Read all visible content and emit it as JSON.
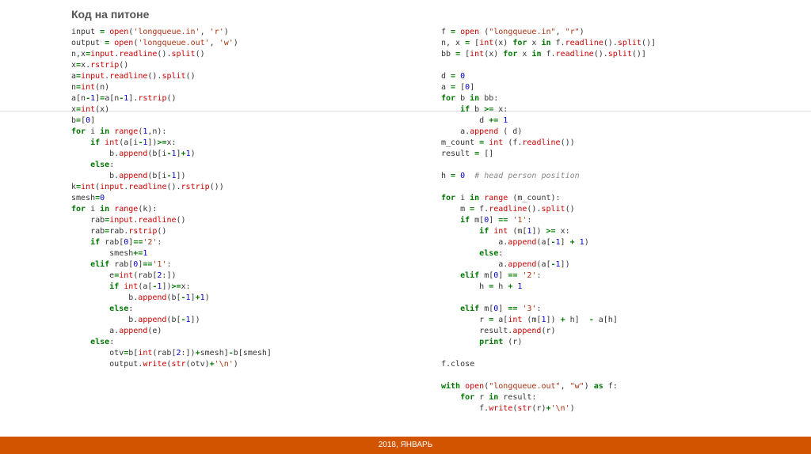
{
  "title": "Код на питоне",
  "footer": "2018, ЯНВАРЬ",
  "code_left": [
    [
      [
        "id",
        "input "
      ],
      [
        "kw",
        "="
      ],
      [
        "id",
        " "
      ],
      [
        "fn",
        "open"
      ],
      [
        "id",
        "("
      ],
      [
        "str",
        "'longqueue.in'"
      ],
      [
        "id",
        ", "
      ],
      [
        "str",
        "'r'"
      ],
      [
        "id",
        ")"
      ]
    ],
    [
      [
        "id",
        "output "
      ],
      [
        "kw",
        "="
      ],
      [
        "id",
        " "
      ],
      [
        "fn",
        "open"
      ],
      [
        "id",
        "("
      ],
      [
        "str",
        "'longqueue.out'"
      ],
      [
        "id",
        ", "
      ],
      [
        "str",
        "'w'"
      ],
      [
        "id",
        ")"
      ]
    ],
    [
      [
        "id",
        "n,x"
      ],
      [
        "kw",
        "="
      ],
      [
        "fn",
        "input"
      ],
      [
        "id",
        "."
      ],
      [
        "fn",
        "readline"
      ],
      [
        "id",
        "()."
      ],
      [
        "fn",
        "split"
      ],
      [
        "id",
        "()"
      ]
    ],
    [
      [
        "id",
        "x"
      ],
      [
        "kw",
        "="
      ],
      [
        "id",
        "x."
      ],
      [
        "fn",
        "rstrip"
      ],
      [
        "id",
        "()"
      ]
    ],
    [
      [
        "id",
        "a"
      ],
      [
        "kw",
        "="
      ],
      [
        "fn",
        "input"
      ],
      [
        "id",
        "."
      ],
      [
        "fn",
        "readline"
      ],
      [
        "id",
        "()."
      ],
      [
        "fn",
        "split"
      ],
      [
        "id",
        "()"
      ]
    ],
    [
      [
        "id",
        "n"
      ],
      [
        "kw",
        "="
      ],
      [
        "fn",
        "int"
      ],
      [
        "id",
        "(n)"
      ]
    ],
    [
      [
        "id",
        "a[n"
      ],
      [
        "kw",
        "-"
      ],
      [
        "num",
        "1"
      ],
      [
        "id",
        "]"
      ],
      [
        "kw",
        "="
      ],
      [
        "id",
        "a[n"
      ],
      [
        "kw",
        "-"
      ],
      [
        "num",
        "1"
      ],
      [
        "id",
        "]."
      ],
      [
        "fn",
        "rstrip"
      ],
      [
        "id",
        "()"
      ]
    ],
    [
      [
        "id",
        "x"
      ],
      [
        "kw",
        "="
      ],
      [
        "fn",
        "int"
      ],
      [
        "id",
        "(x)"
      ]
    ],
    [
      [
        "id",
        "b"
      ],
      [
        "kw",
        "="
      ],
      [
        "id",
        "["
      ],
      [
        "num",
        "0"
      ],
      [
        "id",
        "]"
      ]
    ],
    [
      [
        "kw",
        "for"
      ],
      [
        "id",
        " i "
      ],
      [
        "kw",
        "in"
      ],
      [
        "id",
        " "
      ],
      [
        "fn",
        "range"
      ],
      [
        "id",
        "("
      ],
      [
        "num",
        "1"
      ],
      [
        "id",
        ",n):"
      ]
    ],
    [
      [
        "id",
        "    "
      ],
      [
        "kw",
        "if"
      ],
      [
        "id",
        " "
      ],
      [
        "fn",
        "int"
      ],
      [
        "id",
        "(a[i"
      ],
      [
        "kw",
        "-"
      ],
      [
        "num",
        "1"
      ],
      [
        "id",
        "])"
      ],
      [
        "kw",
        ">="
      ],
      [
        "id",
        "x:"
      ]
    ],
    [
      [
        "id",
        "        b."
      ],
      [
        "fn",
        "append"
      ],
      [
        "id",
        "(b[i"
      ],
      [
        "kw",
        "-"
      ],
      [
        "num",
        "1"
      ],
      [
        "id",
        "]"
      ],
      [
        "kw",
        "+"
      ],
      [
        "num",
        "1"
      ],
      [
        "id",
        ")"
      ]
    ],
    [
      [
        "id",
        "    "
      ],
      [
        "kw",
        "else"
      ],
      [
        "id",
        ":"
      ]
    ],
    [
      [
        "id",
        "        b."
      ],
      [
        "fn",
        "append"
      ],
      [
        "id",
        "(b[i"
      ],
      [
        "kw",
        "-"
      ],
      [
        "num",
        "1"
      ],
      [
        "id",
        "])"
      ]
    ],
    [
      [
        "id",
        "k"
      ],
      [
        "kw",
        "="
      ],
      [
        "fn",
        "int"
      ],
      [
        "id",
        "("
      ],
      [
        "fn",
        "input"
      ],
      [
        "id",
        "."
      ],
      [
        "fn",
        "readline"
      ],
      [
        "id",
        "()."
      ],
      [
        "fn",
        "rstrip"
      ],
      [
        "id",
        "())"
      ]
    ],
    [
      [
        "id",
        "smesh"
      ],
      [
        "kw",
        "="
      ],
      [
        "num",
        "0"
      ]
    ],
    [
      [
        "kw",
        "for"
      ],
      [
        "id",
        " i "
      ],
      [
        "kw",
        "in"
      ],
      [
        "id",
        " "
      ],
      [
        "fn",
        "range"
      ],
      [
        "id",
        "(k):"
      ]
    ],
    [
      [
        "id",
        "    rab"
      ],
      [
        "kw",
        "="
      ],
      [
        "fn",
        "input"
      ],
      [
        "id",
        "."
      ],
      [
        "fn",
        "readline"
      ],
      [
        "id",
        "()"
      ]
    ],
    [
      [
        "id",
        "    rab"
      ],
      [
        "kw",
        "="
      ],
      [
        "id",
        "rab."
      ],
      [
        "fn",
        "rstrip"
      ],
      [
        "id",
        "()"
      ]
    ],
    [
      [
        "id",
        "    "
      ],
      [
        "kw",
        "if"
      ],
      [
        "id",
        " rab["
      ],
      [
        "num",
        "0"
      ],
      [
        "id",
        "]"
      ],
      [
        "kw",
        "=="
      ],
      [
        "str",
        "'2'"
      ],
      [
        "id",
        ":"
      ]
    ],
    [
      [
        "id",
        "        smesh"
      ],
      [
        "kw",
        "+="
      ],
      [
        "num",
        "1"
      ]
    ],
    [
      [
        "id",
        "    "
      ],
      [
        "kw",
        "elif"
      ],
      [
        "id",
        " rab["
      ],
      [
        "num",
        "0"
      ],
      [
        "id",
        "]"
      ],
      [
        "kw",
        "=="
      ],
      [
        "str",
        "'1'"
      ],
      [
        "id",
        ":"
      ]
    ],
    [
      [
        "id",
        "        e"
      ],
      [
        "kw",
        "="
      ],
      [
        "fn",
        "int"
      ],
      [
        "id",
        "(rab["
      ],
      [
        "num",
        "2"
      ],
      [
        "id",
        ":])"
      ]
    ],
    [
      [
        "id",
        "        "
      ],
      [
        "kw",
        "if"
      ],
      [
        "id",
        " "
      ],
      [
        "fn",
        "int"
      ],
      [
        "id",
        "(a["
      ],
      [
        "kw",
        "-"
      ],
      [
        "num",
        "1"
      ],
      [
        "id",
        "])"
      ],
      [
        "kw",
        ">="
      ],
      [
        "id",
        "x:"
      ]
    ],
    [
      [
        "id",
        "            b."
      ],
      [
        "fn",
        "append"
      ],
      [
        "id",
        "(b["
      ],
      [
        "kw",
        "-"
      ],
      [
        "num",
        "1"
      ],
      [
        "id",
        "]"
      ],
      [
        "kw",
        "+"
      ],
      [
        "num",
        "1"
      ],
      [
        "id",
        ")"
      ]
    ],
    [
      [
        "id",
        "        "
      ],
      [
        "kw",
        "else"
      ],
      [
        "id",
        ":"
      ]
    ],
    [
      [
        "id",
        "            b."
      ],
      [
        "fn",
        "append"
      ],
      [
        "id",
        "(b["
      ],
      [
        "kw",
        "-"
      ],
      [
        "num",
        "1"
      ],
      [
        "id",
        "])"
      ]
    ],
    [
      [
        "id",
        "        a."
      ],
      [
        "fn",
        "append"
      ],
      [
        "id",
        "(e)"
      ]
    ],
    [
      [
        "id",
        "    "
      ],
      [
        "kw",
        "else"
      ],
      [
        "id",
        ":"
      ]
    ],
    [
      [
        "id",
        "        otv"
      ],
      [
        "kw",
        "="
      ],
      [
        "id",
        "b["
      ],
      [
        "fn",
        "int"
      ],
      [
        "id",
        "(rab["
      ],
      [
        "num",
        "2"
      ],
      [
        "id",
        ":])"
      ],
      [
        "kw",
        "+"
      ],
      [
        "id",
        "smesh]"
      ],
      [
        "kw",
        "-"
      ],
      [
        "id",
        "b[smesh]"
      ]
    ],
    [
      [
        "id",
        "        output."
      ],
      [
        "fn",
        "write"
      ],
      [
        "id",
        "("
      ],
      [
        "fn",
        "str"
      ],
      [
        "id",
        "(otv)"
      ],
      [
        "kw",
        "+"
      ],
      [
        "str",
        "'\\n'"
      ],
      [
        "id",
        ")"
      ]
    ]
  ],
  "code_right": [
    [
      [
        "id",
        "f "
      ],
      [
        "kw",
        "="
      ],
      [
        "id",
        " "
      ],
      [
        "fn",
        "open"
      ],
      [
        "id",
        " ("
      ],
      [
        "str",
        "\"longqueue.in\""
      ],
      [
        "id",
        ", "
      ],
      [
        "str",
        "\"r\""
      ],
      [
        "id",
        ")"
      ]
    ],
    [
      [
        "id",
        "n, x "
      ],
      [
        "kw",
        "="
      ],
      [
        "id",
        " ["
      ],
      [
        "fn",
        "int"
      ],
      [
        "id",
        "(x) "
      ],
      [
        "kw",
        "for"
      ],
      [
        "id",
        " x "
      ],
      [
        "kw",
        "in"
      ],
      [
        "id",
        " f."
      ],
      [
        "fn",
        "readline"
      ],
      [
        "id",
        "()."
      ],
      [
        "fn",
        "split"
      ],
      [
        "id",
        "()]"
      ]
    ],
    [
      [
        "id",
        "bb "
      ],
      [
        "kw",
        "="
      ],
      [
        "id",
        " ["
      ],
      [
        "fn",
        "int"
      ],
      [
        "id",
        "(x) "
      ],
      [
        "kw",
        "for"
      ],
      [
        "id",
        " x "
      ],
      [
        "kw",
        "in"
      ],
      [
        "id",
        " f."
      ],
      [
        "fn",
        "readline"
      ],
      [
        "id",
        "()."
      ],
      [
        "fn",
        "split"
      ],
      [
        "id",
        "()]"
      ]
    ],
    [],
    [
      [
        "id",
        "d "
      ],
      [
        "kw",
        "="
      ],
      [
        "id",
        " "
      ],
      [
        "num",
        "0"
      ]
    ],
    [
      [
        "id",
        "a "
      ],
      [
        "kw",
        "="
      ],
      [
        "id",
        " ["
      ],
      [
        "num",
        "0"
      ],
      [
        "id",
        "]"
      ]
    ],
    [
      [
        "kw",
        "for"
      ],
      [
        "id",
        " b "
      ],
      [
        "kw",
        "in"
      ],
      [
        "id",
        " bb:"
      ]
    ],
    [
      [
        "id",
        "    "
      ],
      [
        "kw",
        "if"
      ],
      [
        "id",
        " b "
      ],
      [
        "kw",
        ">="
      ],
      [
        "id",
        " x:"
      ]
    ],
    [
      [
        "id",
        "        d "
      ],
      [
        "kw",
        "+="
      ],
      [
        "id",
        " "
      ],
      [
        "num",
        "1"
      ]
    ],
    [
      [
        "id",
        "    a."
      ],
      [
        "fn",
        "append"
      ],
      [
        "id",
        " ( d)"
      ]
    ],
    [
      [
        "id",
        "m_count "
      ],
      [
        "kw",
        "="
      ],
      [
        "id",
        " "
      ],
      [
        "fn",
        "int"
      ],
      [
        "id",
        " (f."
      ],
      [
        "fn",
        "readline"
      ],
      [
        "id",
        "())"
      ]
    ],
    [
      [
        "id",
        "result "
      ],
      [
        "kw",
        "="
      ],
      [
        "id",
        " []"
      ]
    ],
    [],
    [
      [
        "id",
        "h "
      ],
      [
        "kw",
        "="
      ],
      [
        "id",
        " "
      ],
      [
        "num",
        "0"
      ],
      [
        "id",
        "  "
      ],
      [
        "cm",
        "# head person position"
      ]
    ],
    [],
    [
      [
        "kw",
        "for"
      ],
      [
        "id",
        " i "
      ],
      [
        "kw",
        "in"
      ],
      [
        "id",
        " "
      ],
      [
        "fn",
        "range"
      ],
      [
        "id",
        " (m_count):"
      ]
    ],
    [
      [
        "id",
        "    m "
      ],
      [
        "kw",
        "="
      ],
      [
        "id",
        " f."
      ],
      [
        "fn",
        "readline"
      ],
      [
        "id",
        "()."
      ],
      [
        "fn",
        "split"
      ],
      [
        "id",
        "()"
      ]
    ],
    [
      [
        "id",
        "    "
      ],
      [
        "kw",
        "if"
      ],
      [
        "id",
        " m["
      ],
      [
        "num",
        "0"
      ],
      [
        "id",
        "] "
      ],
      [
        "kw",
        "=="
      ],
      [
        "id",
        " "
      ],
      [
        "str",
        "'1'"
      ],
      [
        "id",
        ":"
      ]
    ],
    [
      [
        "id",
        "        "
      ],
      [
        "kw",
        "if"
      ],
      [
        "id",
        " "
      ],
      [
        "fn",
        "int"
      ],
      [
        "id",
        " (m["
      ],
      [
        "num",
        "1"
      ],
      [
        "id",
        "]) "
      ],
      [
        "kw",
        ">="
      ],
      [
        "id",
        " x:"
      ]
    ],
    [
      [
        "id",
        "            a."
      ],
      [
        "fn",
        "append"
      ],
      [
        "id",
        "(a["
      ],
      [
        "kw",
        "-"
      ],
      [
        "num",
        "1"
      ],
      [
        "id",
        "] "
      ],
      [
        "kw",
        "+"
      ],
      [
        "id",
        " "
      ],
      [
        "num",
        "1"
      ],
      [
        "id",
        ")"
      ]
    ],
    [
      [
        "id",
        "        "
      ],
      [
        "kw",
        "else"
      ],
      [
        "id",
        ":"
      ]
    ],
    [
      [
        "id",
        "            a."
      ],
      [
        "fn",
        "append"
      ],
      [
        "id",
        "(a["
      ],
      [
        "kw",
        "-"
      ],
      [
        "num",
        "1"
      ],
      [
        "id",
        "])"
      ]
    ],
    [
      [
        "id",
        "    "
      ],
      [
        "kw",
        "elif"
      ],
      [
        "id",
        " m["
      ],
      [
        "num",
        "0"
      ],
      [
        "id",
        "] "
      ],
      [
        "kw",
        "=="
      ],
      [
        "id",
        " "
      ],
      [
        "str",
        "'2'"
      ],
      [
        "id",
        ":"
      ]
    ],
    [
      [
        "id",
        "        h "
      ],
      [
        "kw",
        "="
      ],
      [
        "id",
        " h "
      ],
      [
        "kw",
        "+"
      ],
      [
        "id",
        " "
      ],
      [
        "num",
        "1"
      ]
    ],
    [],
    [
      [
        "id",
        "    "
      ],
      [
        "kw",
        "elif"
      ],
      [
        "id",
        " m["
      ],
      [
        "num",
        "0"
      ],
      [
        "id",
        "] "
      ],
      [
        "kw",
        "=="
      ],
      [
        "id",
        " "
      ],
      [
        "str",
        "'3'"
      ],
      [
        "id",
        ":"
      ]
    ],
    [
      [
        "id",
        "        r "
      ],
      [
        "kw",
        "="
      ],
      [
        "id",
        " a["
      ],
      [
        "fn",
        "int"
      ],
      [
        "id",
        " (m["
      ],
      [
        "num",
        "1"
      ],
      [
        "id",
        "]) "
      ],
      [
        "kw",
        "+"
      ],
      [
        "id",
        " h]  "
      ],
      [
        "kw",
        "-"
      ],
      [
        "id",
        " a[h]"
      ]
    ],
    [
      [
        "id",
        "        result."
      ],
      [
        "fn",
        "append"
      ],
      [
        "id",
        "(r)"
      ]
    ],
    [
      [
        "id",
        "        "
      ],
      [
        "kw",
        "print"
      ],
      [
        "id",
        " (r)"
      ]
    ],
    [],
    [
      [
        "id",
        "f.close"
      ]
    ],
    [],
    [
      [
        "kw",
        "with"
      ],
      [
        "id",
        " "
      ],
      [
        "fn",
        "open"
      ],
      [
        "id",
        "("
      ],
      [
        "str",
        "\"longqueue.out\""
      ],
      [
        "id",
        ", "
      ],
      [
        "str",
        "\"w\""
      ],
      [
        "id",
        ") "
      ],
      [
        "kw",
        "as"
      ],
      [
        "id",
        " f:"
      ]
    ],
    [
      [
        "id",
        "    "
      ],
      [
        "kw",
        "for"
      ],
      [
        "id",
        " r "
      ],
      [
        "kw",
        "in"
      ],
      [
        "id",
        " result:"
      ]
    ],
    [
      [
        "id",
        "        f."
      ],
      [
        "fn",
        "write"
      ],
      [
        "id",
        "("
      ],
      [
        "fn",
        "str"
      ],
      [
        "id",
        "(r)"
      ],
      [
        "kw",
        "+"
      ],
      [
        "str",
        "'\\n'"
      ],
      [
        "id",
        ")"
      ]
    ]
  ]
}
